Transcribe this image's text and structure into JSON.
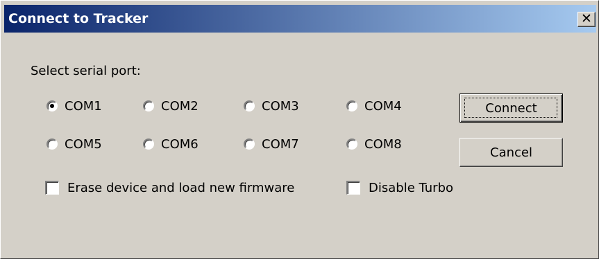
{
  "window": {
    "title": "Connect to Tracker",
    "close_glyph": "✕",
    "title_gradient": [
      "#0a246a",
      "#a6caf0"
    ]
  },
  "serial": {
    "label": "Select serial port:",
    "ports": [
      {
        "label": "COM1",
        "selected": true
      },
      {
        "label": "COM2",
        "selected": false
      },
      {
        "label": "COM3",
        "selected": false
      },
      {
        "label": "COM4",
        "selected": false
      },
      {
        "label": "COM5",
        "selected": false
      },
      {
        "label": "COM6",
        "selected": false
      },
      {
        "label": "COM7",
        "selected": false
      },
      {
        "label": "COM8",
        "selected": false
      }
    ]
  },
  "options": {
    "erase_label": "Erase device and load new firmware",
    "erase_checked": false,
    "turbo_label": "Disable Turbo",
    "turbo_checked": false
  },
  "buttons": {
    "connect": "Connect",
    "cancel": "Cancel"
  }
}
